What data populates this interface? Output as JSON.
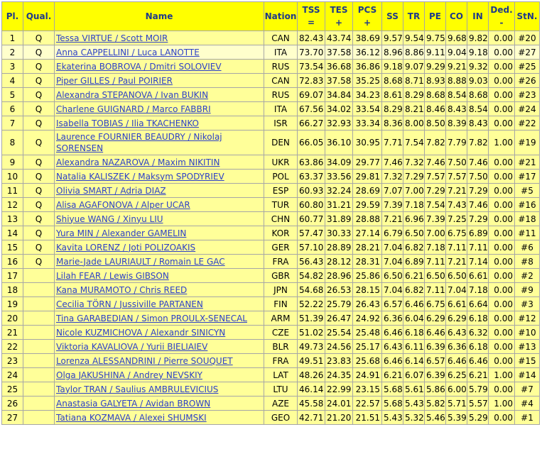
{
  "headers": {
    "pl": "Pl.",
    "qual": "Qual.",
    "name": "Name",
    "nation": "Nation",
    "tss_top": "TSS",
    "tss_bot": "=",
    "tes_top": "TES",
    "tes_bot": "+",
    "pcs_top": "PCS",
    "pcs_bot": "+",
    "ss": "SS",
    "tr": "TR",
    "pe": "PE",
    "co": "CO",
    "in": "IN",
    "ded_top": "Ded.",
    "ded_bot": "-",
    "stn": "StN."
  },
  "rows": [
    {
      "pl": "1",
      "qual": "Q",
      "name": "Tessa VIRTUE / Scott MOIR",
      "nation": "CAN",
      "tss": "82.43",
      "tes": "43.74",
      "pcs": "38.69",
      "ss": "9.57",
      "tr": "9.54",
      "pe": "9.75",
      "co": "9.68",
      "in": "9.82",
      "ded": "0.00",
      "stn": "#20"
    },
    {
      "pl": "2",
      "qual": "Q",
      "name": "Anna CAPPELLINI / Luca LANOTTE",
      "nation": "ITA",
      "tss": "73.70",
      "tes": "37.58",
      "pcs": "36.12",
      "ss": "8.96",
      "tr": "8.86",
      "pe": "9.11",
      "co": "9.04",
      "in": "9.18",
      "ded": "0.00",
      "stn": "#27"
    },
    {
      "pl": "3",
      "qual": "Q",
      "name": "Ekaterina BOBROVA / Dmitri SOLOVIEV",
      "nation": "RUS",
      "tss": "73.54",
      "tes": "36.68",
      "pcs": "36.86",
      "ss": "9.18",
      "tr": "9.07",
      "pe": "9.29",
      "co": "9.21",
      "in": "9.32",
      "ded": "0.00",
      "stn": "#25"
    },
    {
      "pl": "4",
      "qual": "Q",
      "name": "Piper GILLES / Paul POIRIER",
      "nation": "CAN",
      "tss": "72.83",
      "tes": "37.58",
      "pcs": "35.25",
      "ss": "8.68",
      "tr": "8.71",
      "pe": "8.93",
      "co": "8.88",
      "in": "9.03",
      "ded": "0.00",
      "stn": "#26"
    },
    {
      "pl": "5",
      "qual": "Q",
      "name": "Alexandra STEPANOVA / Ivan BUKIN",
      "nation": "RUS",
      "tss": "69.07",
      "tes": "34.84",
      "pcs": "34.23",
      "ss": "8.61",
      "tr": "8.29",
      "pe": "8.68",
      "co": "8.54",
      "in": "8.68",
      "ded": "0.00",
      "stn": "#23"
    },
    {
      "pl": "6",
      "qual": "Q",
      "name": "Charlene GUIGNARD / Marco FABBRI",
      "nation": "ITA",
      "tss": "67.56",
      "tes": "34.02",
      "pcs": "33.54",
      "ss": "8.29",
      "tr": "8.21",
      "pe": "8.46",
      "co": "8.43",
      "in": "8.54",
      "ded": "0.00",
      "stn": "#24"
    },
    {
      "pl": "7",
      "qual": "Q",
      "name": "Isabella TOBIAS / Ilia TKACHENKO",
      "nation": "ISR",
      "tss": "66.27",
      "tes": "32.93",
      "pcs": "33.34",
      "ss": "8.36",
      "tr": "8.00",
      "pe": "8.50",
      "co": "8.39",
      "in": "8.43",
      "ded": "0.00",
      "stn": "#22"
    },
    {
      "pl": "8",
      "qual": "Q",
      "name": "Laurence FOURNIER BEAUDRY / Nikolaj SORENSEN",
      "nation": "DEN",
      "tss": "66.05",
      "tes": "36.10",
      "pcs": "30.95",
      "ss": "7.71",
      "tr": "7.54",
      "pe": "7.82",
      "co": "7.79",
      "in": "7.82",
      "ded": "1.00",
      "stn": "#19"
    },
    {
      "pl": "9",
      "qual": "Q",
      "name": "Alexandra NAZAROVA / Maxim NIKITIN",
      "nation": "UKR",
      "tss": "63.86",
      "tes": "34.09",
      "pcs": "29.77",
      "ss": "7.46",
      "tr": "7.32",
      "pe": "7.46",
      "co": "7.50",
      "in": "7.46",
      "ded": "0.00",
      "stn": "#21"
    },
    {
      "pl": "10",
      "qual": "Q",
      "name": "Natalia KALISZEK / Maksym SPODYRIEV",
      "nation": "POL",
      "tss": "63.37",
      "tes": "33.56",
      "pcs": "29.81",
      "ss": "7.32",
      "tr": "7.29",
      "pe": "7.57",
      "co": "7.57",
      "in": "7.50",
      "ded": "0.00",
      "stn": "#17"
    },
    {
      "pl": "11",
      "qual": "Q",
      "name": "Olivia SMART / Adria DIAZ",
      "nation": "ESP",
      "tss": "60.93",
      "tes": "32.24",
      "pcs": "28.69",
      "ss": "7.07",
      "tr": "7.00",
      "pe": "7.29",
      "co": "7.21",
      "in": "7.29",
      "ded": "0.00",
      "stn": "#5"
    },
    {
      "pl": "12",
      "qual": "Q",
      "name": "Alisa AGAFONOVA / Alper UCAR",
      "nation": "TUR",
      "tss": "60.80",
      "tes": "31.21",
      "pcs": "29.59",
      "ss": "7.39",
      "tr": "7.18",
      "pe": "7.54",
      "co": "7.43",
      "in": "7.46",
      "ded": "0.00",
      "stn": "#16"
    },
    {
      "pl": "13",
      "qual": "Q",
      "name": "Shiyue WANG / Xinyu LIU",
      "nation": "CHN",
      "tss": "60.77",
      "tes": "31.89",
      "pcs": "28.88",
      "ss": "7.21",
      "tr": "6.96",
      "pe": "7.39",
      "co": "7.25",
      "in": "7.29",
      "ded": "0.00",
      "stn": "#18"
    },
    {
      "pl": "14",
      "qual": "Q",
      "name": "Yura MIN / Alexander GAMELIN",
      "nation": "KOR",
      "tss": "57.47",
      "tes": "30.33",
      "pcs": "27.14",
      "ss": "6.79",
      "tr": "6.50",
      "pe": "7.00",
      "co": "6.75",
      "in": "6.89",
      "ded": "0.00",
      "stn": "#11"
    },
    {
      "pl": "15",
      "qual": "Q",
      "name": "Kavita LORENZ / Joti POLIZOAKIS",
      "nation": "GER",
      "tss": "57.10",
      "tes": "28.89",
      "pcs": "28.21",
      "ss": "7.04",
      "tr": "6.82",
      "pe": "7.18",
      "co": "7.11",
      "in": "7.11",
      "ded": "0.00",
      "stn": "#6"
    },
    {
      "pl": "16",
      "qual": "Q",
      "name": "Marie-Jade LAURIAULT / Romain LE GAC",
      "nation": "FRA",
      "tss": "56.43",
      "tes": "28.12",
      "pcs": "28.31",
      "ss": "7.04",
      "tr": "6.89",
      "pe": "7.11",
      "co": "7.21",
      "in": "7.14",
      "ded": "0.00",
      "stn": "#8"
    },
    {
      "pl": "17",
      "qual": "",
      "name": "Lilah FEAR / Lewis GIBSON",
      "nation": "GBR",
      "tss": "54.82",
      "tes": "28.96",
      "pcs": "25.86",
      "ss": "6.50",
      "tr": "6.21",
      "pe": "6.50",
      "co": "6.50",
      "in": "6.61",
      "ded": "0.00",
      "stn": "#2"
    },
    {
      "pl": "18",
      "qual": "",
      "name": "Kana MURAMOTO / Chris REED",
      "nation": "JPN",
      "tss": "54.68",
      "tes": "26.53",
      "pcs": "28.15",
      "ss": "7.04",
      "tr": "6.82",
      "pe": "7.11",
      "co": "7.04",
      "in": "7.18",
      "ded": "0.00",
      "stn": "#9"
    },
    {
      "pl": "19",
      "qual": "",
      "name": "Cecilia TÖRN / Jussiville PARTANEN",
      "nation": "FIN",
      "tss": "52.22",
      "tes": "25.79",
      "pcs": "26.43",
      "ss": "6.57",
      "tr": "6.46",
      "pe": "6.75",
      "co": "6.61",
      "in": "6.64",
      "ded": "0.00",
      "stn": "#3"
    },
    {
      "pl": "20",
      "qual": "",
      "name": "Tina GARABEDIAN / Simon PROULX-SENECAL",
      "nation": "ARM",
      "tss": "51.39",
      "tes": "26.47",
      "pcs": "24.92",
      "ss": "6.36",
      "tr": "6.04",
      "pe": "6.29",
      "co": "6.29",
      "in": "6.18",
      "ded": "0.00",
      "stn": "#12"
    },
    {
      "pl": "21",
      "qual": "",
      "name": "Nicole KUZMICHOVA / Alexandr SINICYN",
      "nation": "CZE",
      "tss": "51.02",
      "tes": "25.54",
      "pcs": "25.48",
      "ss": "6.46",
      "tr": "6.18",
      "pe": "6.46",
      "co": "6.43",
      "in": "6.32",
      "ded": "0.00",
      "stn": "#10"
    },
    {
      "pl": "22",
      "qual": "",
      "name": "Viktoria KAVALIOVA / Yurii BIELIAIEV",
      "nation": "BLR",
      "tss": "49.73",
      "tes": "24.56",
      "pcs": "25.17",
      "ss": "6.43",
      "tr": "6.11",
      "pe": "6.39",
      "co": "6.36",
      "in": "6.18",
      "ded": "0.00",
      "stn": "#13"
    },
    {
      "pl": "23",
      "qual": "",
      "name": "Lorenza ALESSANDRINI / Pierre SOUQUET",
      "nation": "FRA",
      "tss": "49.51",
      "tes": "23.83",
      "pcs": "25.68",
      "ss": "6.46",
      "tr": "6.14",
      "pe": "6.57",
      "co": "6.46",
      "in": "6.46",
      "ded": "0.00",
      "stn": "#15"
    },
    {
      "pl": "24",
      "qual": "",
      "name": "Olga JAKUSHINA / Andrey NEVSKIY",
      "nation": "LAT",
      "tss": "48.26",
      "tes": "24.35",
      "pcs": "24.91",
      "ss": "6.21",
      "tr": "6.07",
      "pe": "6.39",
      "co": "6.25",
      "in": "6.21",
      "ded": "1.00",
      "stn": "#14"
    },
    {
      "pl": "25",
      "qual": "",
      "name": "Taylor TRAN / Saulius AMBRULEVICIUS",
      "nation": "LTU",
      "tss": "46.14",
      "tes": "22.99",
      "pcs": "23.15",
      "ss": "5.68",
      "tr": "5.61",
      "pe": "5.86",
      "co": "6.00",
      "in": "5.79",
      "ded": "0.00",
      "stn": "#7"
    },
    {
      "pl": "26",
      "qual": "",
      "name": "Anastasia GALYETA / Avidan BROWN",
      "nation": "AZE",
      "tss": "45.58",
      "tes": "24.01",
      "pcs": "22.57",
      "ss": "5.68",
      "tr": "5.43",
      "pe": "5.82",
      "co": "5.71",
      "in": "5.57",
      "ded": "1.00",
      "stn": "#4"
    },
    {
      "pl": "27",
      "qual": "",
      "name": "Tatiana KOZMAVA / Alexei SHUMSKI",
      "nation": "GEO",
      "tss": "42.71",
      "tes": "21.20",
      "pcs": "21.51",
      "ss": "5.43",
      "tr": "5.32",
      "pe": "5.46",
      "co": "5.39",
      "in": "5.29",
      "ded": "0.00",
      "stn": "#1"
    }
  ]
}
